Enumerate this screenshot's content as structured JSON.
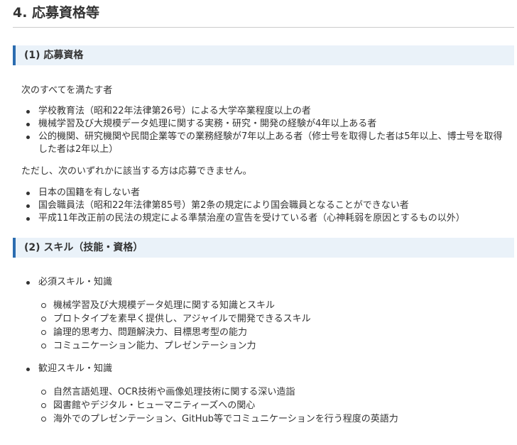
{
  "section": {
    "title": "4. 応募資格等"
  },
  "qualification": {
    "heading": "(1) 応募資格",
    "intro": "次のすべてを満たす者",
    "requirements": [
      "学校教育法（昭和22年法律第26号）による大学卒業程度以上の者",
      "機械学習及び大規模データ処理に関する実務・研究・開発の経験が4年以上ある者",
      "公的機関、研究機関や民間企業等での業務経験が7年以上ある者（修士号を取得した者は5年以上、博士号を取得した者は2年以上）"
    ],
    "exclusion_intro": "ただし、次のいずれかに該当する方は応募できません。",
    "exclusions": [
      "日本の国籍を有しない者",
      "国会職員法（昭和22年法律第85号）第2条の規定により国会職員となることができない者",
      "平成11年改正前の民法の規定による準禁治産の宣告を受けている者（心神耗弱を原因とするもの以外）"
    ]
  },
  "skills": {
    "heading": "(2) スキル（技能・資格）",
    "required": {
      "label": "必須スキル・知識",
      "items": [
        "機械学習及び大規模データ処理に関する知識とスキル",
        "プロトタイプを素早く提供し、アジャイルで開発できるスキル",
        "論理的思考力、問題解決力、目標思考型の能力",
        "コミュニケーション能力、プレゼンテーション力"
      ]
    },
    "preferred": {
      "label": "歓迎スキル・知識",
      "items": [
        "自然言語処理、OCR技術や画像処理技術に関する深い造詣",
        "図書館やデジタル・ヒューマニティーズへの関心",
        "海外でのプレゼンテーション、GitHub等でコミュニケーションを行う程度の英語力"
      ]
    }
  }
}
